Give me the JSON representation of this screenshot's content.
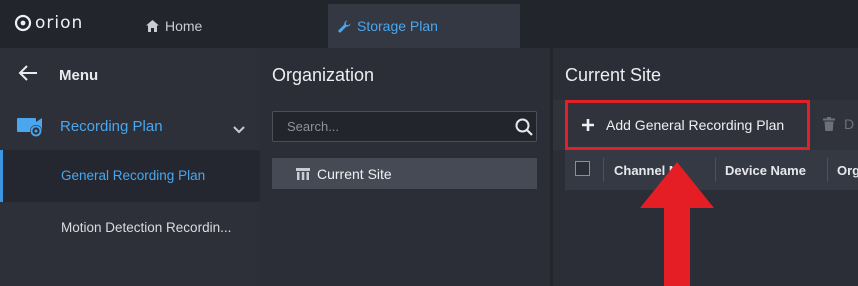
{
  "header": {
    "logo_text": "orion",
    "tabs": [
      {
        "label": "Home",
        "icon": "home-icon"
      },
      {
        "label": "Storage Plan",
        "icon": "wrench-icon"
      }
    ]
  },
  "sidebar": {
    "menu_label": "Menu",
    "group": {
      "label": "Recording Plan",
      "icon": "camera-settings-icon"
    },
    "items": [
      {
        "label": "General Recording Plan",
        "active": true
      },
      {
        "label": "Motion Detection Recordin..."
      }
    ]
  },
  "organization": {
    "title": "Organization",
    "search": {
      "placeholder": "Search...",
      "value": ""
    },
    "tree": [
      {
        "label": "Current Site",
        "icon": "site-icon"
      }
    ]
  },
  "current_site": {
    "title": "Current Site",
    "toolbar": {
      "add_label": "Add General Recording Plan",
      "delete_label": "D"
    },
    "table": {
      "columns": [
        "Channel N",
        "Device Name",
        "Org"
      ]
    }
  },
  "colors": {
    "accent": "#4aa6ee",
    "highlight": "#e12028",
    "topbar": "#22252c",
    "panel": "#2b2e36"
  }
}
